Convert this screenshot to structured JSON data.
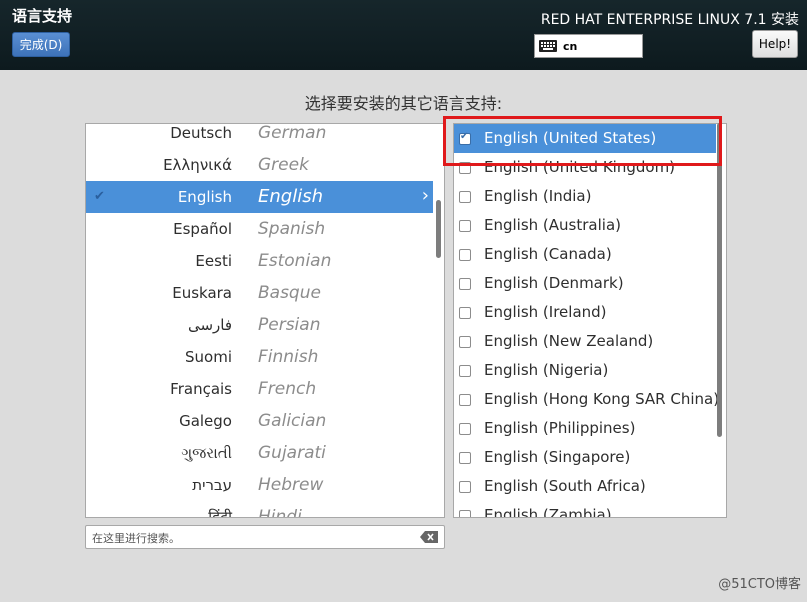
{
  "header": {
    "spoke_title": "语言支持",
    "done_label": "完成(D)",
    "product_title": "RED HAT ENTERPRISE LINUX 7.1 安装",
    "keyboard_layout": "cn",
    "help_label": "Help!"
  },
  "main": {
    "heading": "选择要安装的其它语言支持:"
  },
  "languages": [
    {
      "native": "Deutsch",
      "english": "German"
    },
    {
      "native": "Ελληνικά",
      "english": "Greek"
    },
    {
      "native": "English",
      "english": "English",
      "selected": true
    },
    {
      "native": "Español",
      "english": "Spanish"
    },
    {
      "native": "Eesti",
      "english": "Estonian"
    },
    {
      "native": "Euskara",
      "english": "Basque"
    },
    {
      "native": "فارسی",
      "english": "Persian"
    },
    {
      "native": "Suomi",
      "english": "Finnish"
    },
    {
      "native": "Français",
      "english": "French"
    },
    {
      "native": "Galego",
      "english": "Galician"
    },
    {
      "native": "ગુજરાતી",
      "english": "Gujarati"
    },
    {
      "native": "עברית",
      "english": "Hebrew"
    },
    {
      "native": "हिंदी",
      "english": "Hindi"
    }
  ],
  "locales": [
    {
      "label": "English (United States)",
      "checked": true,
      "selected": true
    },
    {
      "label": "English (United Kingdom)"
    },
    {
      "label": "English (India)"
    },
    {
      "label": "English (Australia)"
    },
    {
      "label": "English (Canada)"
    },
    {
      "label": "English (Denmark)"
    },
    {
      "label": "English (Ireland)"
    },
    {
      "label": "English (New Zealand)"
    },
    {
      "label": "English (Nigeria)"
    },
    {
      "label": "English (Hong Kong SAR China)"
    },
    {
      "label": "English (Philippines)"
    },
    {
      "label": "English (Singapore)"
    },
    {
      "label": "English (South Africa)"
    },
    {
      "label": "English (Zambia)"
    }
  ],
  "search": {
    "placeholder": "在这里进行搜索。",
    "value": ""
  },
  "watermark": "@51CTO博客",
  "colors": {
    "header_bg": "#0d1a1e",
    "selection": "#4a90d9",
    "highlight": "#e0191b"
  }
}
